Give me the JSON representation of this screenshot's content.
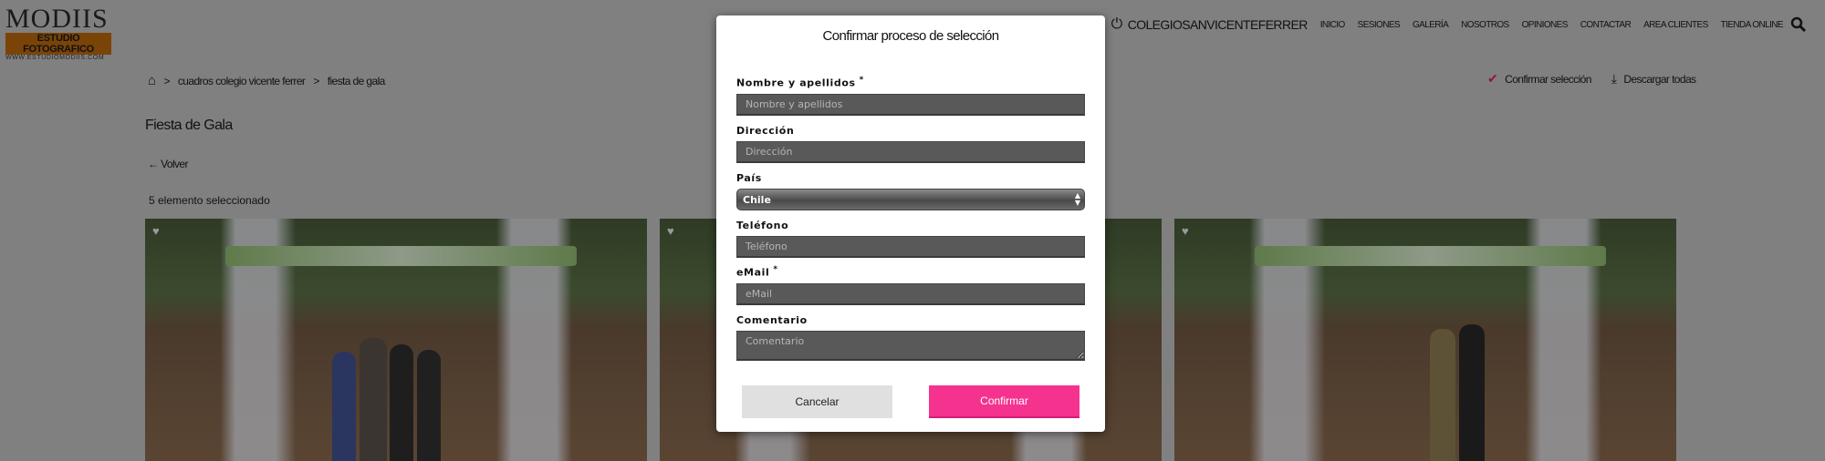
{
  "header": {
    "logo": {
      "name": "MODIIS",
      "tagline": "ESTUDIO FOTOGRAFICO",
      "url_text": "WWW.ESTUDIOMODIIS.COM"
    },
    "user": "COLEGIOSANVICENTEFERRER",
    "nav": [
      "INICIO",
      "SESIONES",
      "GALERÍA",
      "NOSOTROS",
      "OPINIONES",
      "CONTACTAR",
      "AREA CLIENTES",
      "TIENDA ONLINE"
    ]
  },
  "breadcrumb": {
    "sep": ">",
    "items": [
      "cuadros colegio vicente ferrer",
      "fiesta de gala"
    ]
  },
  "actions": {
    "confirm": "Confirmar selección",
    "download": "Descargar todas",
    "accent": "#c2185b"
  },
  "page": {
    "title": "Fiesta de Gala",
    "back": "Volver",
    "selected_count": "5 elemento seleccionado"
  },
  "modal": {
    "title": "Confirmar proceso de selección",
    "fields": {
      "name": {
        "label": "Nombre y apellidos",
        "required": "*",
        "placeholder": "Nombre y apellidos"
      },
      "address": {
        "label": "Dirección",
        "placeholder": "Dirección"
      },
      "country": {
        "label": "País",
        "value": "Chile"
      },
      "phone": {
        "label": "Teléfono",
        "placeholder": "Teléfono"
      },
      "email": {
        "label": "eMail",
        "required": "*",
        "placeholder": "eMail"
      },
      "comment": {
        "label": "Comentario",
        "placeholder": "Comentario"
      }
    },
    "cancel": "Cancelar",
    "confirm": "Confirmar",
    "confirm_color": "#f5338f"
  }
}
